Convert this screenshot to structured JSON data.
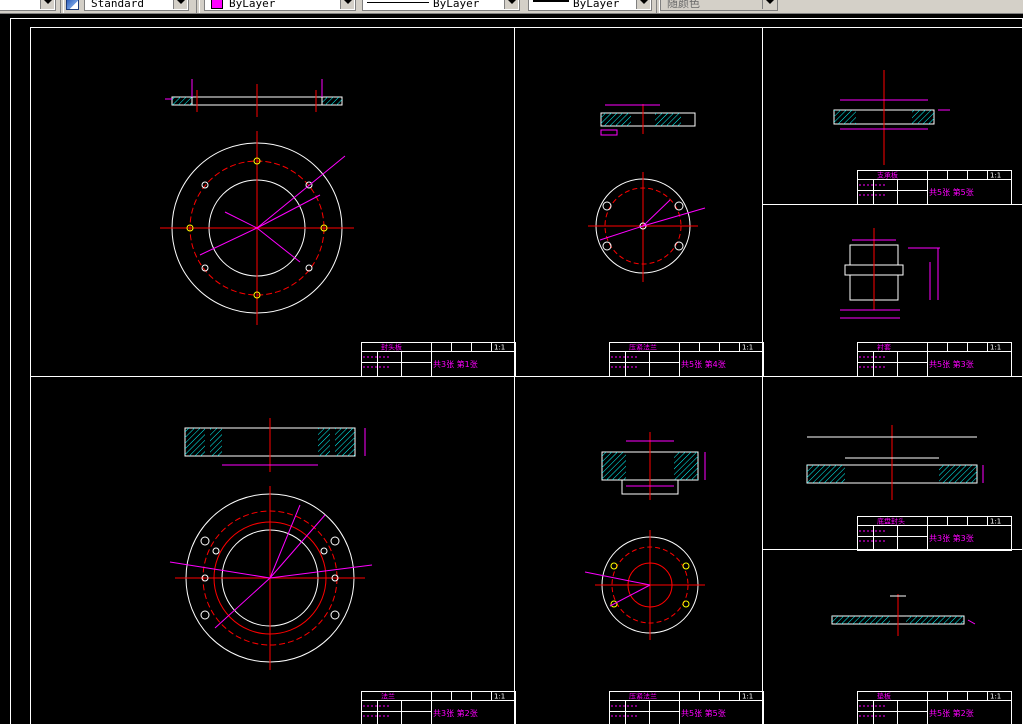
{
  "toolbar": {
    "text_style": "Standard",
    "layer_color_label": "ByLayer",
    "linetype_label": "ByLayer",
    "lineweight_label": "ByLayer",
    "plot_style_label": "随颜色"
  },
  "colors": {
    "background": "#000000",
    "frame": "#ffffff",
    "centerline": "#ff0000",
    "dimension": "#ff00ff",
    "hatch": "#00ffff",
    "highlight": "#ffff00",
    "layer_swatch": "#ff00ff"
  },
  "title_blocks": {
    "sheet_1": {
      "scale": "1:1",
      "part_name": "封头板",
      "sheet": "共3张 第1张"
    },
    "sheet_2": {
      "scale": "1:1",
      "part_name": "压紧法兰",
      "sheet": "共5张 第4张"
    },
    "sheet_3": {
      "scale": "1:1",
      "part_name": "支承板",
      "sheet": "共5张 第5张"
    },
    "sheet_4": {
      "scale": "1:1",
      "part_name": "衬套",
      "sheet": "共5张 第3张"
    },
    "sheet_5": {
      "scale": "1:1",
      "part_name": "法兰",
      "sheet": "共3张 第2张"
    },
    "sheet_6": {
      "scale": "1:1",
      "part_name": "压紧法兰",
      "sheet": "共5张 第5张"
    },
    "sheet_7": {
      "scale": "1:1",
      "part_name": "底盘封头",
      "sheet": "共3张 第3张"
    },
    "sheet_8": {
      "scale": "1:1",
      "part_name": "垫板",
      "sheet": "共5张 第2张"
    }
  }
}
